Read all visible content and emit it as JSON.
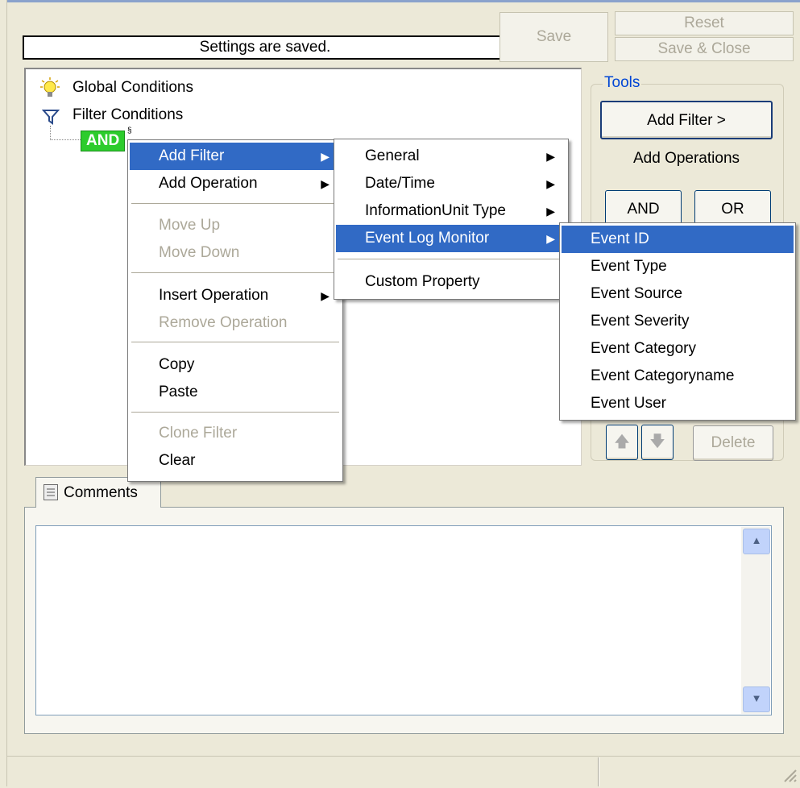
{
  "status": {
    "message": "Settings are saved."
  },
  "toolbar": {
    "save": "Save",
    "reset": "Reset",
    "save_close": "Save & Close"
  },
  "tree": {
    "items": [
      {
        "label": "Global Conditions",
        "icon": "lightbulb-icon"
      },
      {
        "label": "Filter Conditions",
        "icon": "funnel-icon"
      }
    ],
    "and_node": "AND"
  },
  "tools": {
    "title": "Tools",
    "add_filter": "Add Filter >",
    "add_operations_label": "Add Operations",
    "and_button": "AND",
    "or_button": "OR",
    "delete_button": "Delete"
  },
  "comments": {
    "tab_label": "Comments"
  },
  "context_menu": {
    "items": [
      {
        "label": "Add Filter",
        "submenu": true,
        "state": "selected"
      },
      {
        "label": "Add Operation",
        "submenu": true,
        "state": "normal"
      },
      {
        "label": "Move Up",
        "submenu": false,
        "state": "disabled"
      },
      {
        "label": "Move Down",
        "submenu": false,
        "state": "disabled"
      },
      {
        "label": "Insert Operation",
        "submenu": true,
        "state": "normal"
      },
      {
        "label": "Remove Operation",
        "submenu": false,
        "state": "disabled"
      },
      {
        "label": "Copy",
        "submenu": false,
        "state": "normal"
      },
      {
        "label": "Paste",
        "submenu": false,
        "state": "normal"
      },
      {
        "label": "Clone Filter",
        "submenu": false,
        "state": "disabled"
      },
      {
        "label": "Clear",
        "submenu": false,
        "state": "normal"
      }
    ]
  },
  "add_filter_submenu": {
    "items": [
      {
        "label": "General",
        "submenu": true
      },
      {
        "label": "Date/Time",
        "submenu": true
      },
      {
        "label": "InformationUnit Type",
        "submenu": true
      },
      {
        "label": "Event Log Monitor",
        "submenu": true,
        "selected": true
      },
      {
        "label": "Custom Property",
        "submenu": false
      }
    ]
  },
  "event_log_submenu": {
    "items": [
      {
        "label": "Event ID",
        "selected": true
      },
      {
        "label": "Event Type"
      },
      {
        "label": "Event Source"
      },
      {
        "label": "Event Severity"
      },
      {
        "label": "Event Category"
      },
      {
        "label": "Event Categoryname"
      },
      {
        "label": "Event User"
      }
    ]
  },
  "colors": {
    "selection": "#316ac5",
    "and_badge": "#2dcc2d",
    "window_bg": "#ece9d8",
    "tools_label": "#0046d5"
  }
}
